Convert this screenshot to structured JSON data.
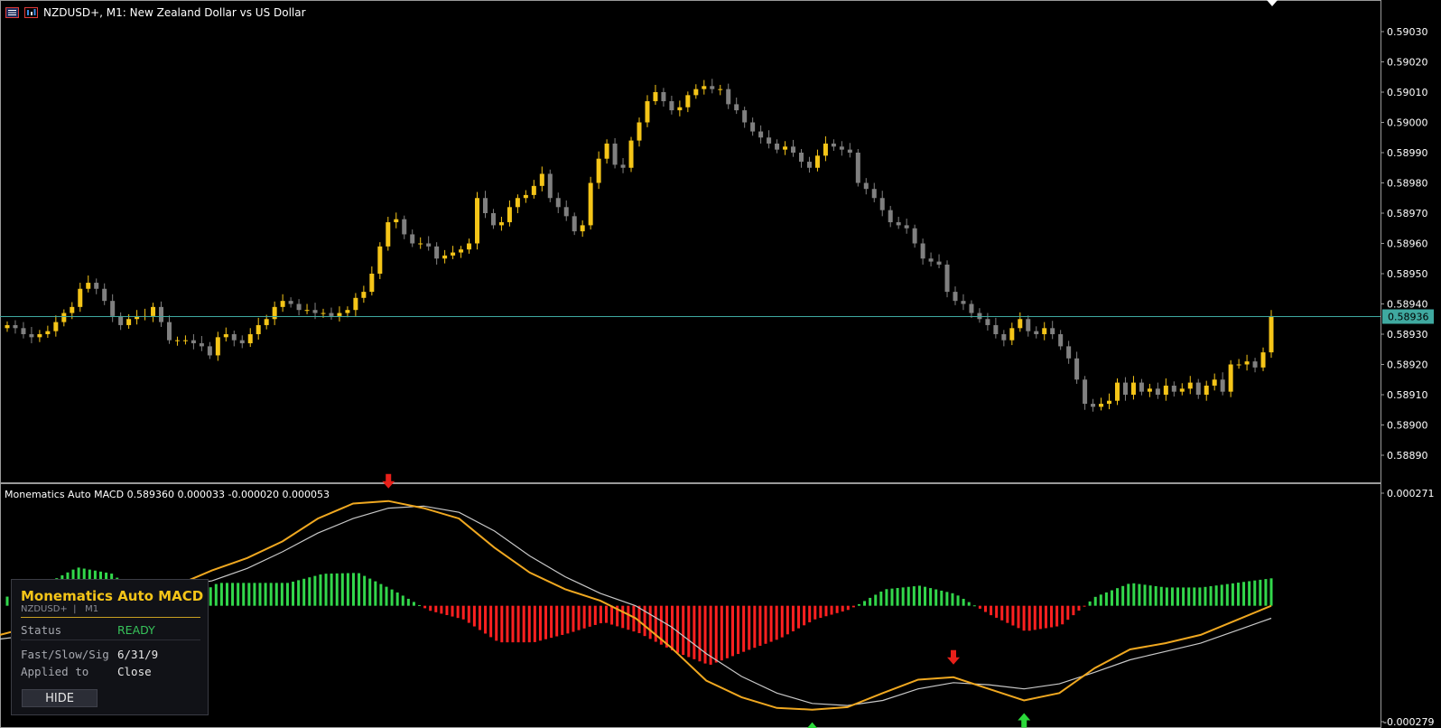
{
  "window": {
    "title": "NZDUSD+, M1:  New Zealand Dollar vs US Dollar",
    "icons": [
      "chart-list-icon",
      "chart-bars-icon"
    ]
  },
  "price_axis": {
    "labels": [
      "0.59030",
      "0.59020",
      "0.59010",
      "0.59000",
      "0.58990",
      "0.58980",
      "0.58970",
      "0.58960",
      "0.58950",
      "0.58940",
      "0.58930",
      "0.58920",
      "0.58910",
      "0.58900",
      "0.58890"
    ],
    "current_price": "0.58936"
  },
  "indicator": {
    "label": "Monematics Auto MACD 0.589360 0.000033 -0.000020 0.000053",
    "axis_top": "0.000271",
    "axis_bottom": "-0.000279"
  },
  "panel": {
    "title": "Monematics  Auto MACD",
    "symbol": "NZDUSD+",
    "divider": "|",
    "timeframe": "M1",
    "status_label": "Status",
    "status_value": "READY",
    "params_label": "Fast/Slow/Sig",
    "params_value": "6/31/9",
    "applied_label": "Applied to",
    "applied_value": "Close",
    "hide_button": "HIDE"
  },
  "colors": {
    "background": "#000000",
    "bull_candle": "#f5c518",
    "bear_candle": "#808080",
    "bid_line": "#3fa9a0",
    "macd_line": "#f0a820",
    "signal_line": "#c8c8c8",
    "hist_positive": "#32d74b",
    "hist_negative": "#ff2020",
    "arrow_up": "#2bd93a",
    "arrow_down": "#e8201a"
  },
  "chart_data": [
    {
      "type": "candlestick",
      "symbol": "NZDUSD+",
      "timeframe": "M1",
      "ylim": [
        0.58884,
        0.59034
      ],
      "bid": 0.58936,
      "closes": [
        0.58933,
        0.58932,
        0.5893,
        0.58929,
        0.5893,
        0.58931,
        0.58934,
        0.58937,
        0.58939,
        0.58945,
        0.58947,
        0.58945,
        0.58941,
        0.58936,
        0.58933,
        0.58935,
        0.58936,
        0.58936,
        0.58939,
        0.58934,
        0.58928,
        0.58928,
        0.58928,
        0.58927,
        0.58926,
        0.58923,
        0.58929,
        0.5893,
        0.58928,
        0.58927,
        0.5893,
        0.58933,
        0.58935,
        0.58939,
        0.58941,
        0.5894,
        0.58938,
        0.58938,
        0.58937,
        0.58937,
        0.58936,
        0.58937,
        0.58938,
        0.58942,
        0.58944,
        0.5895,
        0.58959,
        0.58967,
        0.58968,
        0.58963,
        0.5896,
        0.5896,
        0.58959,
        0.58955,
        0.58956,
        0.58957,
        0.58958,
        0.5896,
        0.58975,
        0.5897,
        0.58966,
        0.58967,
        0.58972,
        0.58975,
        0.58976,
        0.58979,
        0.58983,
        0.58975,
        0.58972,
        0.58969,
        0.58964,
        0.58966,
        0.5898,
        0.58988,
        0.58993,
        0.58986,
        0.58985,
        0.58994,
        0.59,
        0.59007,
        0.5901,
        0.59007,
        0.59004,
        0.59005,
        0.59009,
        0.59011,
        0.59012,
        0.59011,
        0.59011,
        0.59006,
        0.59004,
        0.59,
        0.58997,
        0.58995,
        0.58993,
        0.58991,
        0.58992,
        0.5899,
        0.58987,
        0.58985,
        0.58989,
        0.58993,
        0.58992,
        0.58991,
        0.5899,
        0.5898,
        0.58978,
        0.58975,
        0.58971,
        0.58967,
        0.58966,
        0.58965,
        0.5896,
        0.58955,
        0.58954,
        0.58953,
        0.58944,
        0.58941,
        0.5894,
        0.58937,
        0.58935,
        0.58933,
        0.5893,
        0.58928,
        0.58932,
        0.58935,
        0.58931,
        0.5893,
        0.58932,
        0.5893,
        0.58926,
        0.58922,
        0.58915,
        0.58907,
        0.58906,
        0.58907,
        0.58908,
        0.58914,
        0.5891,
        0.58914,
        0.58911,
        0.58912,
        0.5891,
        0.58913,
        0.58911,
        0.58912,
        0.58914,
        0.5891,
        0.58913,
        0.58915,
        0.58911,
        0.5892,
        0.5892,
        0.58921,
        0.58919,
        0.58924,
        0.58936
      ],
      "current": 0.58936
    },
    {
      "type": "line+bar",
      "name": "Monematics Auto MACD",
      "ylim": [
        -0.000279,
        0.000271
      ],
      "values": {
        "first": 3.3e-05,
        "second": -2e-05,
        "third": 5.3e-05
      },
      "series": [
        {
          "kind": "macd_line",
          "values": [
            -7e-05,
            -4.8e-05,
            1.2e-05,
            5.5e-05,
            4.2e-05,
            4.9e-05,
            8.5e-05,
            0.000115,
            0.000155,
            0.00021,
            0.000246,
            0.000252,
            0.000235,
            0.00021,
            0.00014,
            8e-05,
            4e-05,
            1.2e-05,
            -3e-05,
            -0.0001,
            -0.00018,
            -0.00022,
            -0.000246,
            -0.00025,
            -0.000244,
            -0.00021,
            -0.000178,
            -0.000172,
            -0.0002,
            -0.000228,
            -0.00021,
            -0.00015,
            -0.000105,
            -9e-05,
            -7e-05,
            -3.5e-05,
            0.0
          ]
        },
        {
          "kind": "signal_line",
          "values": [
            -8e-05,
            -7e-05,
            -3e-05,
            2e-05,
            4e-05,
            4.7e-05,
            6e-05,
            9e-05,
            0.00013,
            0.000175,
            0.00021,
            0.000235,
            0.00024,
            0.000225,
            0.00018,
            0.00012,
            7e-05,
            3e-05,
            0.0,
            -5e-05,
            -0.000115,
            -0.00017,
            -0.00021,
            -0.000235,
            -0.00024,
            -0.000228,
            -0.0002,
            -0.000185,
            -0.00019,
            -0.0002,
            -0.000188,
            -0.00016,
            -0.00013,
            -0.00011,
            -9e-05,
            -6e-05,
            -3e-05
          ]
        }
      ],
      "annotations": [
        {
          "type": "arrow-down",
          "color": "red",
          "near": "macd peak"
        },
        {
          "type": "arrow-up",
          "color": "green",
          "near": "macd trough"
        },
        {
          "type": "arrow-down",
          "color": "red",
          "near": "second macd hump"
        },
        {
          "type": "arrow-up",
          "color": "green",
          "near": "second macd trough"
        }
      ]
    }
  ]
}
